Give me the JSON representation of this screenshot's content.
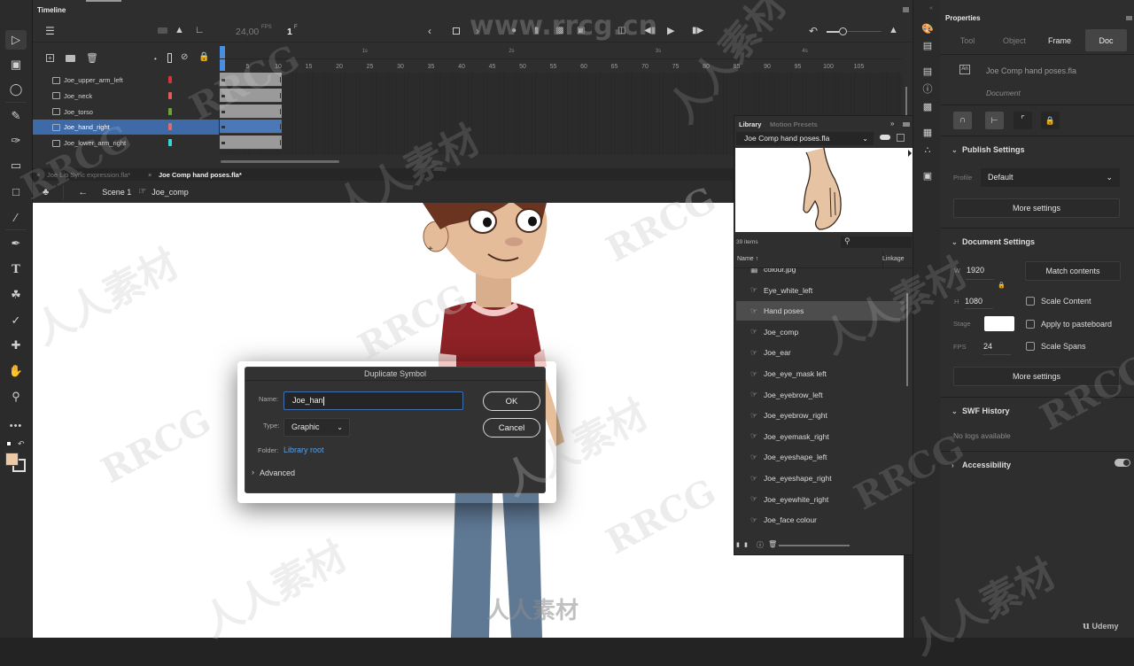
{
  "timeline": {
    "title": "Timeline",
    "fps": "24,00",
    "fps_unit": "FPS",
    "current_frame": "1",
    "frame_unit": "F",
    "layers": [
      {
        "name": "Joe_upper_arm_left",
        "color": "#d8333a",
        "selected": false
      },
      {
        "name": "Joe_neck",
        "color": "#e05a5a",
        "selected": false
      },
      {
        "name": "Joe_torso",
        "color": "#6aa52e",
        "selected": false
      },
      {
        "name": "Joe_hand_right",
        "color": "#e06a6a",
        "selected": true
      },
      {
        "name": "Joe_lower_arm_right",
        "color": "#38d6d6",
        "selected": false
      }
    ],
    "frame_ticks": [
      "5",
      "10",
      "15",
      "20",
      "25",
      "30",
      "35",
      "40",
      "45",
      "50",
      "55",
      "60",
      "65",
      "70",
      "75",
      "80",
      "85",
      "90",
      "95",
      "100",
      "105"
    ],
    "second_marks": [
      "1s",
      "2s",
      "3s",
      "4s"
    ]
  },
  "doc_tabs": [
    {
      "label": "Joe Lip Sync expression.fla*",
      "active": false
    },
    {
      "label": "Joe Comp hand poses.fla*",
      "active": true
    }
  ],
  "breadcrumb": {
    "scene": "Scene 1",
    "symbol": "Joe_comp"
  },
  "dialog": {
    "title": "Duplicate Symbol",
    "name_label": "Name:",
    "name_value": "Joe_han",
    "type_label": "Type:",
    "type_value": "Graphic",
    "folder_label": "Folder:",
    "folder_value": "Library root",
    "advanced_label": "Advanced",
    "ok_label": "OK",
    "cancel_label": "Cancel",
    "link_color": "#5aa0e6"
  },
  "library": {
    "tab_library": "Library",
    "tab_presets": "Motion Presets",
    "document": "Joe Comp hand poses.fla",
    "item_count": "39 items",
    "col_name": "Name",
    "col_linkage": "Linkage",
    "items": [
      {
        "name": "colour.jpg",
        "type": "bitmap",
        "selected": false
      },
      {
        "name": "Eye_white_left",
        "type": "graphic",
        "selected": false
      },
      {
        "name": "Hand poses",
        "type": "graphic",
        "selected": true
      },
      {
        "name": "Joe_comp",
        "type": "graphic",
        "selected": false
      },
      {
        "name": "Joe_ear",
        "type": "graphic",
        "selected": false
      },
      {
        "name": "Joe_eye_mask left",
        "type": "graphic",
        "selected": false
      },
      {
        "name": "Joe_eyebrow_left",
        "type": "graphic",
        "selected": false
      },
      {
        "name": "Joe_eyebrow_right",
        "type": "graphic",
        "selected": false
      },
      {
        "name": "Joe_eyemask_right",
        "type": "graphic",
        "selected": false
      },
      {
        "name": "Joe_eyeshape_left",
        "type": "graphic",
        "selected": false
      },
      {
        "name": "Joe_eyeshape_right",
        "type": "graphic",
        "selected": false
      },
      {
        "name": "Joe_eyewhite_right",
        "type": "graphic",
        "selected": false
      },
      {
        "name": "Joe_face colour",
        "type": "graphic",
        "selected": false
      }
    ]
  },
  "properties": {
    "title": "Properties",
    "tabs": [
      "Tool",
      "Object",
      "Frame",
      "Doc"
    ],
    "active_tab": "Doc",
    "doc_name": "Joe Comp hand poses.fla",
    "doc_kind": "Document",
    "doc_badge": "An",
    "publish": {
      "header": "Publish Settings",
      "profile_label": "Profile",
      "profile_value": "Default",
      "more_settings": "More settings"
    },
    "document_settings": {
      "header": "Document Settings",
      "w_label": "W",
      "w_value": "1920",
      "h_label": "H",
      "h_value": "1080",
      "stage_label": "Stage",
      "stage_color": "#ffffff",
      "fps_label": "FPS",
      "fps_value": "24",
      "match_contents": "Match contents",
      "scale_content": "Scale Content",
      "apply_pasteboard": "Apply to pasteboard",
      "scale_spans": "Scale Spans",
      "more_settings": "More settings"
    },
    "swf_history": {
      "header": "SWF History",
      "empty": "No logs available"
    },
    "accessibility": {
      "header": "Accessibility",
      "toggle_on": true
    }
  },
  "watermark": {
    "url": "www.rrcg.cn",
    "brand": "RRCG",
    "cn": "人人素材",
    "udemy": "Udemy"
  }
}
